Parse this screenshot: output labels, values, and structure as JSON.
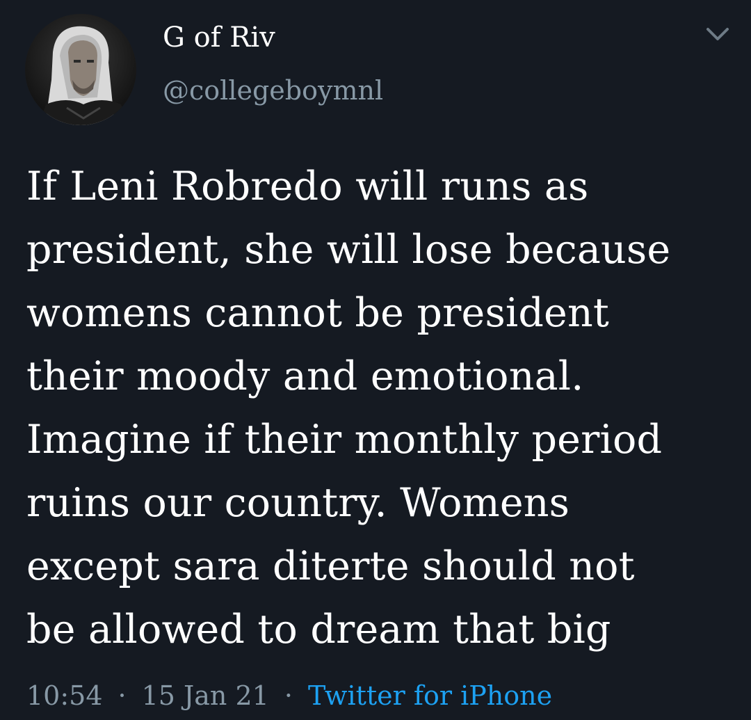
{
  "tweet": {
    "author": {
      "display_name": "G of Riv",
      "handle": "@collegeboymnl",
      "avatar_icon": "avatar-portrait-icon"
    },
    "menu_icon": "chevron-down-icon",
    "text": "If Leni Robredo will runs as\npresident, she will lose because\nwomens cannot be president\ntheir moody and emotional.\nImagine if their monthly period\nruins our country. Womens\nexcept sara diterte should not\nbe allowed to dream that big",
    "meta": {
      "time": "10:54",
      "separator": "·",
      "date": "15 Jan 21",
      "source": "Twitter for iPhone"
    }
  },
  "colors": {
    "background": "#151a22",
    "text_primary": "#ffffff",
    "text_secondary": "#8899a6",
    "accent": "#1da1f2"
  }
}
